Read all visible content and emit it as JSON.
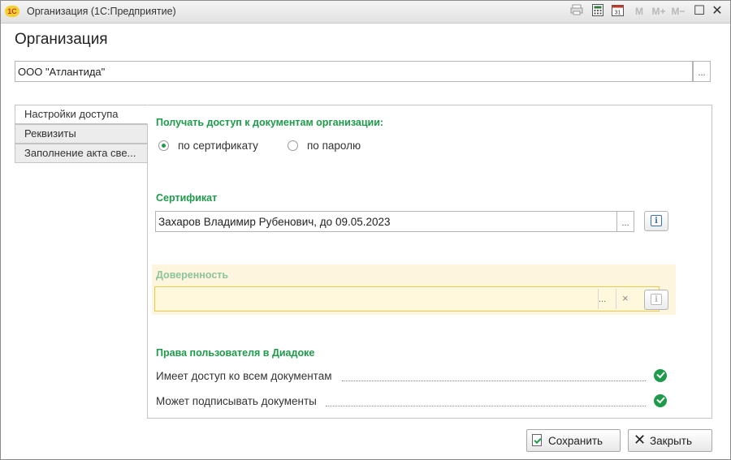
{
  "window": {
    "title": "Организация (1С:Предприятие)",
    "logo_text": "1С",
    "toolbar": {
      "m": "M",
      "m_plus": "M+",
      "m_minus": "M−",
      "maximize": "☐",
      "close": "✕",
      "calendar_day": "31"
    }
  },
  "header": {
    "title": "Организация",
    "organization_value": "ООО \"Атлантида\"",
    "select_label": "..."
  },
  "tabs": [
    {
      "label": "Настройки доступа",
      "active": true
    },
    {
      "label": "Реквизиты",
      "active": false
    },
    {
      "label": "Заполнение акта све...",
      "active": false
    }
  ],
  "access": {
    "heading": "Получать доступ к документам организации:",
    "options": [
      {
        "label": "по сертификату",
        "checked": true
      },
      {
        "label": "по паролю",
        "checked": false
      }
    ]
  },
  "certificate": {
    "heading": "Сертификат",
    "value": "Захаров Владимир Рубенович, до 09.05.2023",
    "select_label": "...",
    "info_label": "i"
  },
  "proxy": {
    "heading": "Доверенность",
    "value": "",
    "select_label": "...",
    "clear_label": "×",
    "info_label": "i"
  },
  "rights": {
    "heading": "Права пользователя в Диадоке",
    "items": [
      {
        "label": "Имеет доступ ко всем документам",
        "granted": true
      },
      {
        "label": "Может подписывать документы",
        "granted": true
      }
    ]
  },
  "footer": {
    "save_label": "Сохранить",
    "close_label": "Закрыть"
  },
  "colors": {
    "accent_green": "#1d9b4a",
    "highlight_yellow": "#fdf5de",
    "info_blue": "#3b6fb6"
  }
}
